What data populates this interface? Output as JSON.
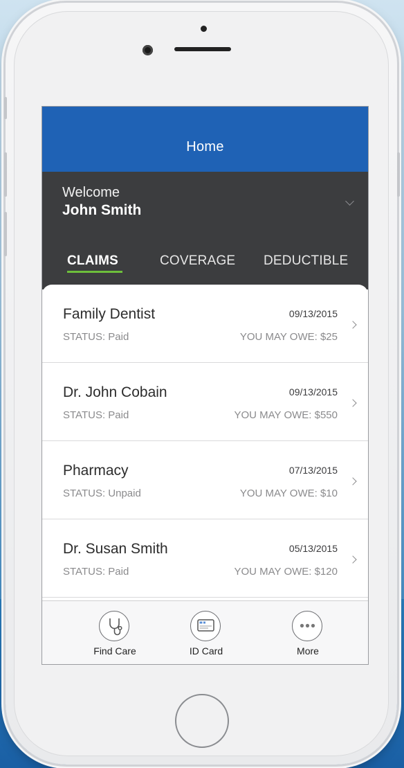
{
  "app": {
    "title": "Home",
    "accent_color": "#1f62b5",
    "tab_indicator_color": "#6dbf3b"
  },
  "welcome": {
    "label": "Welcome",
    "user_name": "John Smith"
  },
  "tabs": [
    {
      "label": "CLAIMS",
      "active": true
    },
    {
      "label": "COVERAGE",
      "active": false
    },
    {
      "label": "DEDUCTIBLE",
      "active": false
    }
  ],
  "claims": [
    {
      "name": "Family Dentist",
      "status": "STATUS: Paid",
      "date": "09/13/2015",
      "owe": "YOU MAY OWE: $25"
    },
    {
      "name": "Dr. John Cobain",
      "status": "STATUS: Paid",
      "date": "09/13/2015",
      "owe": "YOU MAY OWE: $550"
    },
    {
      "name": "Pharmacy",
      "status": "STATUS: Unpaid",
      "date": "07/13/2015",
      "owe": "YOU MAY OWE: $10"
    },
    {
      "name": "Dr. Susan Smith",
      "status": "STATUS: Paid",
      "date": "05/13/2015",
      "owe": "YOU MAY OWE: $120"
    }
  ],
  "bottom_nav": [
    {
      "label": "Find Care",
      "icon": "stethoscope-icon"
    },
    {
      "label": "ID Card",
      "icon": "id-card-icon"
    },
    {
      "label": "More",
      "icon": "more-dots-icon"
    }
  ]
}
